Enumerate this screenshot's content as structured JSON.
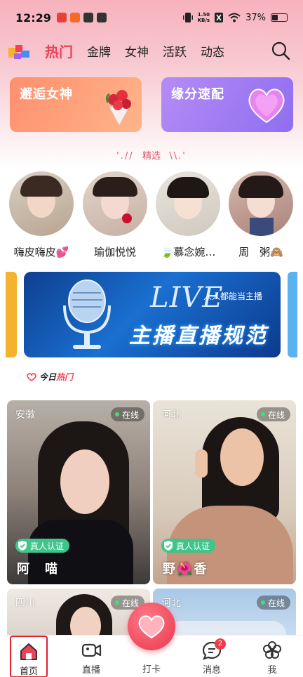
{
  "status_bar": {
    "time": "12:29",
    "net_speed_value": "1.50",
    "net_speed_unit": "KB/s",
    "battery": "37%"
  },
  "header": {
    "tabs": [
      {
        "label": "热门",
        "active": true
      },
      {
        "label": "金牌",
        "active": false
      },
      {
        "label": "女神",
        "active": false
      },
      {
        "label": "活跃",
        "active": false
      },
      {
        "label": "动态",
        "active": false
      }
    ]
  },
  "promos": {
    "left_title": "邂逅女神",
    "right_title": "缘分速配"
  },
  "featured": {
    "label": "精选"
  },
  "avatars": [
    {
      "name": "嗨皮嗨皮💕"
    },
    {
      "name": "瑜伽悦悦"
    },
    {
      "name": "🍃慕念婉…"
    },
    {
      "name": "周　粥🙈"
    }
  ],
  "live_banner": {
    "word": "LIVE",
    "subtitle": "人人都能当主播",
    "title": "主播直播规范"
  },
  "hot_today": {
    "part1": "今日",
    "part2": "热门"
  },
  "cards": [
    {
      "province": "安徽",
      "status": "在线",
      "verify": "真人认证",
      "name": "阿　喵"
    },
    {
      "province": "河北",
      "status": "在线",
      "verify": "真人认证",
      "name": "野🌺香"
    },
    {
      "province": "四川",
      "status": "在线"
    },
    {
      "province": "河北",
      "status": "在线"
    }
  ],
  "bottom_nav": {
    "home": "首页",
    "live": "直播",
    "punch": "打卡",
    "messages": "消息",
    "messages_badge": "2",
    "me": "我"
  },
  "colors": {
    "accent": "#f0405a",
    "verify": "#3fc58a"
  }
}
